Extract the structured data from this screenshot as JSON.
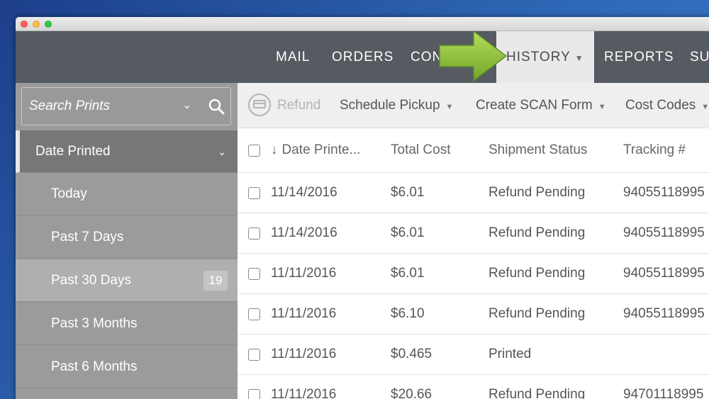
{
  "nav": {
    "items": [
      {
        "label": "MAIL"
      },
      {
        "label": "ORDERS"
      },
      {
        "label": "CON"
      },
      {
        "label": "HISTORY"
      },
      {
        "label": "REPORTS"
      },
      {
        "label": "SU"
      }
    ]
  },
  "sidebar": {
    "search_placeholder": "Search Prints",
    "items": [
      {
        "label": "Date Printed"
      },
      {
        "label": "Today"
      },
      {
        "label": "Past 7 Days"
      },
      {
        "label": "Past 30 Days",
        "count": "19"
      },
      {
        "label": "Past 3 Months"
      },
      {
        "label": "Past 6 Months"
      }
    ]
  },
  "toolbar": {
    "refund": "Refund",
    "schedule_pickup": "Schedule Pickup",
    "create_scan_form": "Create SCAN Form",
    "cost_codes": "Cost Codes"
  },
  "table": {
    "headers": {
      "date": "Date Printe...",
      "total_cost": "Total Cost",
      "status": "Shipment Status",
      "tracking": "Tracking #"
    },
    "rows": [
      {
        "date": "11/14/2016",
        "cost": "$6.01",
        "status": "Refund Pending",
        "tracking": "94055118995"
      },
      {
        "date": "11/14/2016",
        "cost": "$6.01",
        "status": "Refund Pending",
        "tracking": "94055118995"
      },
      {
        "date": "11/11/2016",
        "cost": "$6.01",
        "status": "Refund Pending",
        "tracking": "94055118995"
      },
      {
        "date": "11/11/2016",
        "cost": "$6.10",
        "status": "Refund Pending",
        "tracking": "94055118995"
      },
      {
        "date": "11/11/2016",
        "cost": "$0.465",
        "status": "Printed",
        "tracking": ""
      },
      {
        "date": "11/11/2016",
        "cost": "$20.66",
        "status": "Refund Pending",
        "tracking": "94701118995"
      }
    ]
  },
  "colors": {
    "nav_bg": "#555b60",
    "sidebar_bg": "#9b9b9b",
    "arrow_green": "#8cc63f"
  },
  "icons": [
    "search-icon",
    "chevron-down-icon",
    "refund-icon",
    "sort-down-arrow-icon",
    "checkbox-icon",
    "pointer-arrow-icon"
  ]
}
